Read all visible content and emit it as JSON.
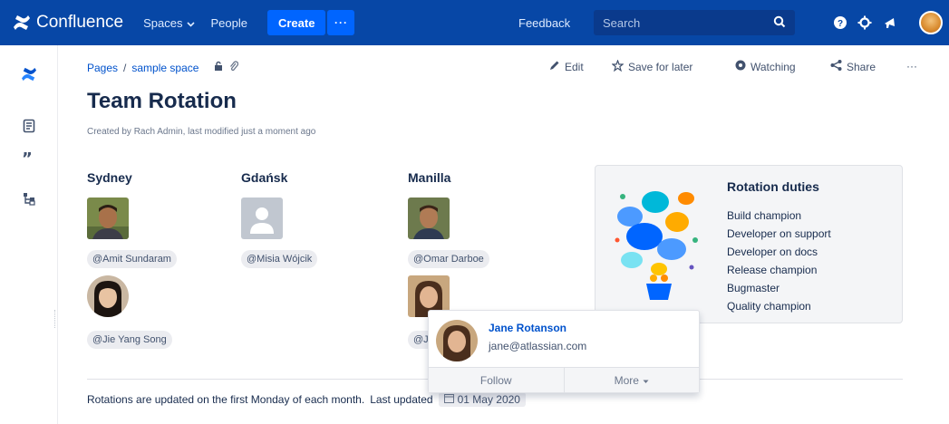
{
  "topnav": {
    "brand": "Confluence",
    "spaces_label": "Spaces",
    "people_label": "People",
    "create_label": "Create",
    "more_label": "···",
    "feedback_label": "Feedback",
    "search_placeholder": "Search"
  },
  "breadcrumb": {
    "pages": "Pages",
    "separator": "/",
    "space": "sample space"
  },
  "actions": {
    "edit": "Edit",
    "save_for_later": "Save for later",
    "watching": "Watching",
    "share": "Share",
    "more": "···"
  },
  "page": {
    "title": "Team Rotation",
    "byline": "Created by Rach Admin, last modified just a moment ago"
  },
  "teams": [
    {
      "city": "Sydney",
      "members": [
        "@Amit Sundaram",
        "@Jie Yang Song"
      ]
    },
    {
      "city": "Gdańsk",
      "members": [
        "@Misia Wójcik"
      ]
    },
    {
      "city": "Manilla",
      "members": [
        "@Omar Darboe",
        "@J..."
      ]
    }
  ],
  "duties": {
    "title": "Rotation duties",
    "items": [
      "Build champion",
      "Developer on support",
      "Developer on docs",
      "Release champion",
      "Bugmaster",
      "Quality champion"
    ]
  },
  "hovercard": {
    "name": "Jane Rotanson",
    "email": "jane@atlassian.com",
    "follow": "Follow",
    "more": "More"
  },
  "footer": {
    "text": "Rotations are updated on the first Monday of each month.",
    "last_updated_label": "Last updated",
    "date": "01 May 2020"
  },
  "colors": {
    "nav_bg": "#0747a6",
    "create_bg": "#0065ff",
    "link": "#0052cc"
  }
}
